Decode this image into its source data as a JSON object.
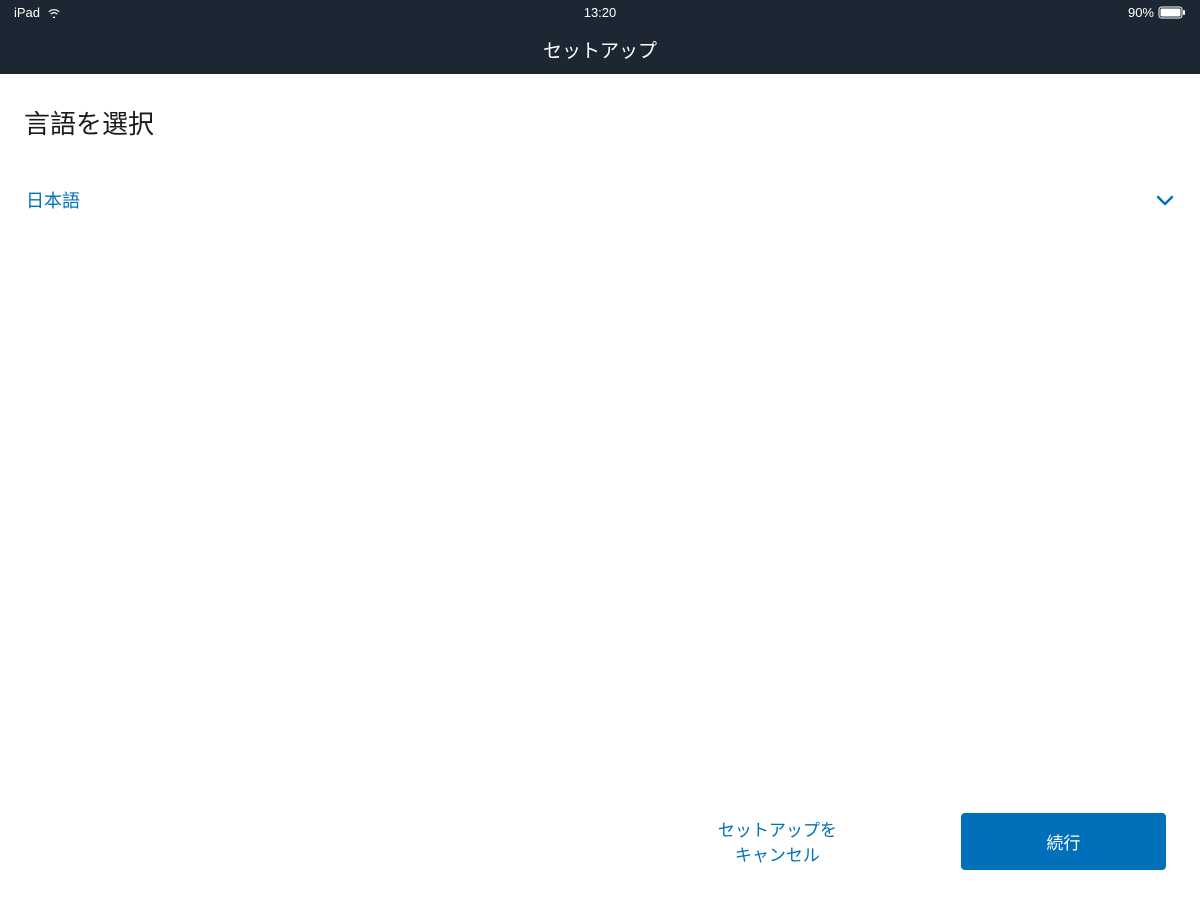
{
  "status": {
    "device": "iPad",
    "time": "13:20",
    "battery_pct": "90%"
  },
  "nav": {
    "title": "セットアップ"
  },
  "main": {
    "heading": "言語を選択",
    "selected_language": "日本語"
  },
  "footer": {
    "cancel_label": "セットアップをキャンセル",
    "continue_label": "続行"
  },
  "colors": {
    "accent": "#0070ba",
    "header_bg": "#1c2733"
  }
}
